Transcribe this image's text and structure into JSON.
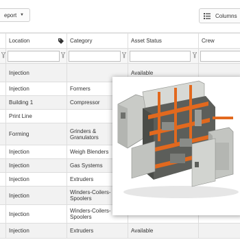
{
  "toolbar": {
    "report_label": "eport",
    "columns_label": "Columns"
  },
  "table": {
    "headers": [
      "",
      "Location",
      "Category",
      "Asset Status",
      "Crew"
    ],
    "rows": [
      {
        "location": "Injection",
        "category": "",
        "status": "Available"
      },
      {
        "location": "Injection",
        "category": "Formers",
        "status": ""
      },
      {
        "location": "Building 1",
        "category": "Compressor",
        "status": ""
      },
      {
        "location": "Print Line",
        "category": "",
        "status": ""
      },
      {
        "location": "Forming",
        "category": "Grinders & Granulators",
        "status": ""
      },
      {
        "location": "Injection",
        "category": "Weigh Blenders",
        "status": ""
      },
      {
        "location": "Injection",
        "category": "Gas Systems",
        "status": ""
      },
      {
        "location": "Injection",
        "category": "Extruders",
        "status": ""
      },
      {
        "location": "Injection",
        "category": "Winders-Coilers-Spoolers",
        "status": ""
      },
      {
        "location": "Injection",
        "category": "Winders-Coilers-Spoolers",
        "status": ""
      },
      {
        "location": "Injection",
        "category": "Extruders",
        "status": "Available"
      }
    ]
  },
  "colors": {
    "available": "#3f9b3f",
    "machine_primary": "#e2691e",
    "cabinet_grey": "#c9cbc7"
  }
}
